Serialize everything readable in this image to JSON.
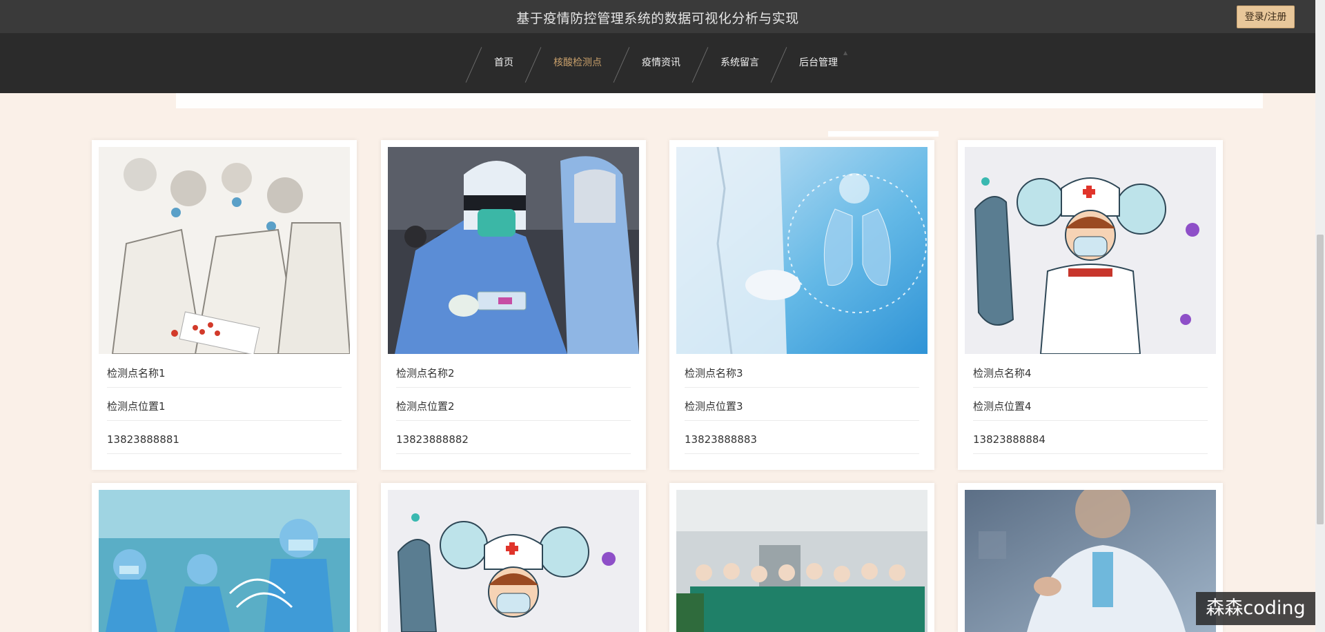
{
  "header": {
    "site_title": "基于疫情防控管理系统的数据可视化分析与实现",
    "login_label": "登录/注册"
  },
  "nav": {
    "items": [
      {
        "label": "首页",
        "active": false
      },
      {
        "label": "核酸检测点",
        "active": true
      },
      {
        "label": "疫情资讯",
        "active": false
      },
      {
        "label": "系统留言",
        "active": false
      },
      {
        "label": "后台管理",
        "active": false
      }
    ]
  },
  "cards": [
    {
      "name": "检测点名称1",
      "location": "检测点位置1",
      "phone": "13823888881"
    },
    {
      "name": "检测点名称2",
      "location": "检测点位置2",
      "phone": "13823888882"
    },
    {
      "name": "检测点名称3",
      "location": "检测点位置3",
      "phone": "13823888883"
    },
    {
      "name": "检测点名称4",
      "location": "检测点位置4",
      "phone": "13823888884"
    },
    {
      "name": "",
      "location": "",
      "phone": ""
    },
    {
      "name": "",
      "location": "",
      "phone": ""
    },
    {
      "name": "",
      "location": "",
      "phone": ""
    },
    {
      "name": "",
      "location": "",
      "phone": ""
    }
  ],
  "watermark": "森森coding",
  "colors": {
    "page_bg": "#faf0e8",
    "header_bg": "#3a3a3a",
    "nav_bg": "#2b2b2b",
    "nav_active": "#c9a06b",
    "login_bg": "#e8c79a"
  }
}
